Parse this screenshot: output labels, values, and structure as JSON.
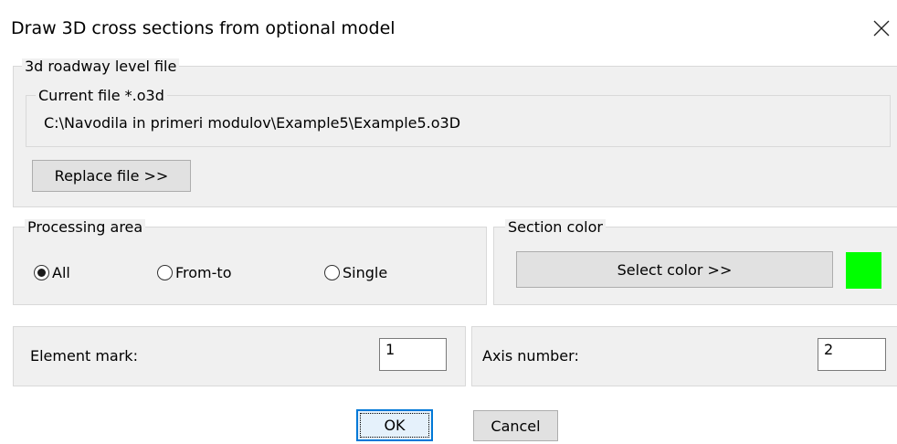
{
  "window": {
    "title": "Draw 3D cross sections from optional model",
    "close_icon": "close-icon"
  },
  "file_group": {
    "legend": "3d roadway level file",
    "current_legend": "Current file *.o3d",
    "path": "C:\\Navodila in primeri modulov\\Example5\\Example5.o3D",
    "replace_button": "Replace file >>"
  },
  "processing_area": {
    "legend": "Processing area",
    "options": [
      "All",
      "From-to",
      "Single"
    ],
    "selected": "All"
  },
  "section_color": {
    "legend": "Section color",
    "select_button": "Select color >>",
    "swatch_color": "#00ff00"
  },
  "element_mark": {
    "label": "Element mark:",
    "value": "1"
  },
  "axis_number": {
    "label": "Axis number:",
    "value": "2"
  },
  "footer": {
    "ok": "OK",
    "cancel": "Cancel"
  }
}
